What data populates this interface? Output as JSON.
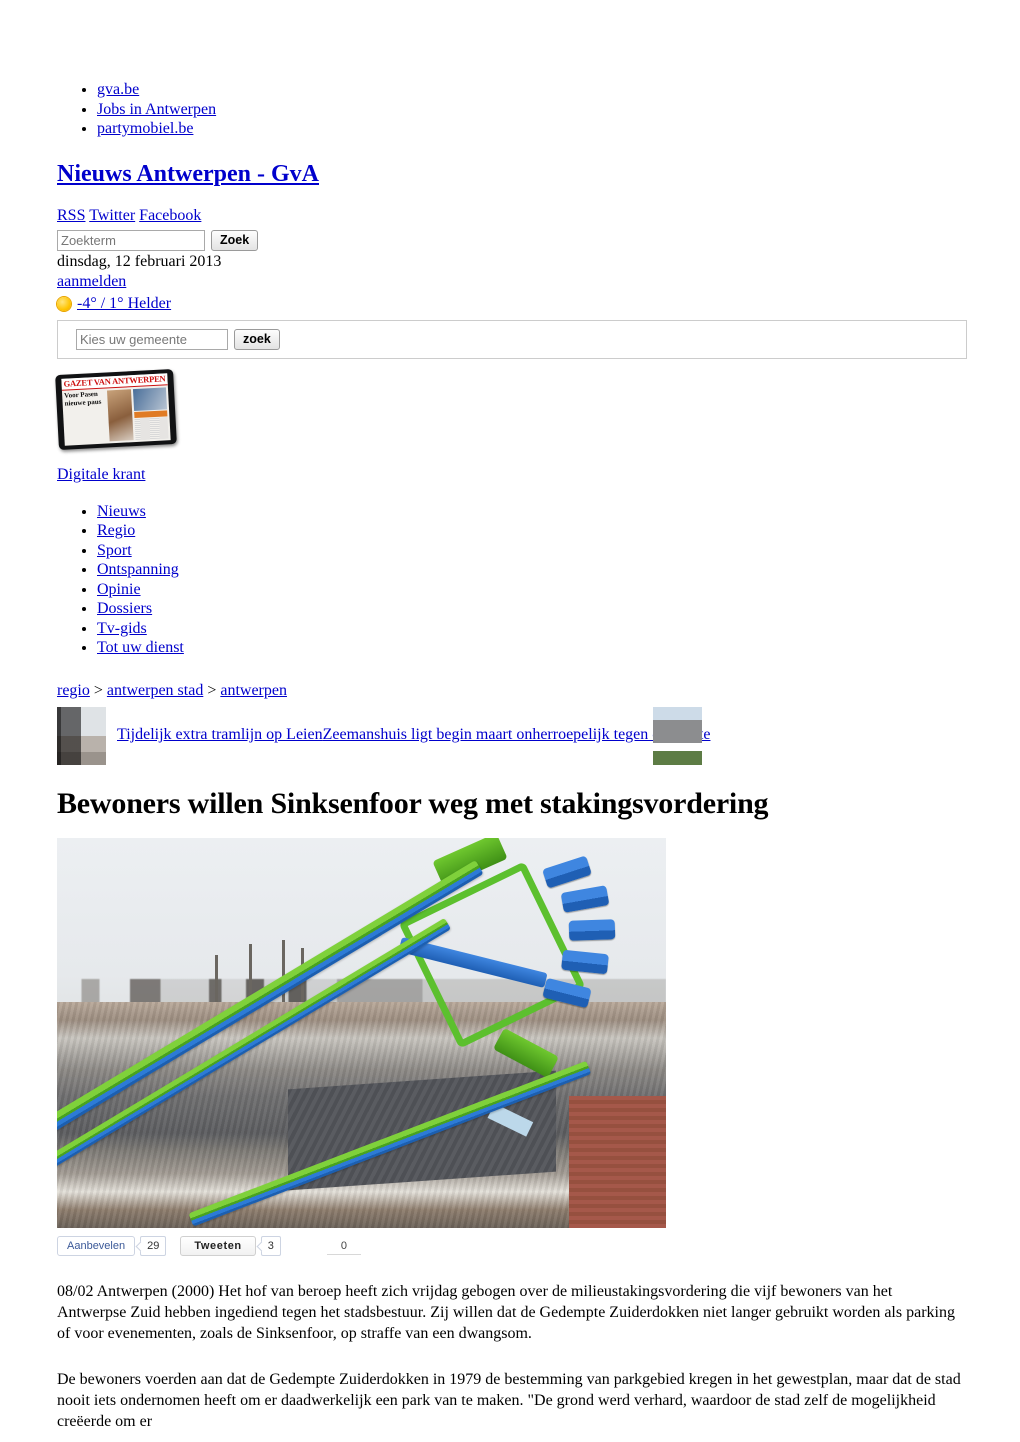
{
  "top_links": [
    {
      "label": "gva.be"
    },
    {
      "label": "Jobs in Antwerpen"
    },
    {
      "label": "partymobiel.be"
    }
  ],
  "site": {
    "title": "Nieuws Antwerpen - GvA"
  },
  "social_links": [
    {
      "label": "RSS"
    },
    {
      "label": "Twitter"
    },
    {
      "label": "Facebook"
    }
  ],
  "search": {
    "placeholder": "Zoekterm",
    "value": "",
    "button_label": "Zoek"
  },
  "date": "dinsdag, 12 februari 2013",
  "login": {
    "label": "aanmelden"
  },
  "weather": {
    "icon": "sun-icon",
    "text": "-4° / 1° Helder"
  },
  "gemeente": {
    "placeholder": "Kies uw gemeente",
    "value": "",
    "button_label": "zoek"
  },
  "krant": {
    "masthead": "GAZET VAN ANTWERPEN",
    "front_headline": "Voor Pasen nieuwe paus",
    "link_label": "Digitale krant"
  },
  "nav": [
    {
      "label": "Nieuws"
    },
    {
      "label": "Regio"
    },
    {
      "label": "Sport"
    },
    {
      "label": "Ontspanning"
    },
    {
      "label": "Opinie"
    },
    {
      "label": "Dossiers"
    },
    {
      "label": "Tv-gids"
    },
    {
      "label": "Tot uw dienst"
    }
  ],
  "breadcrumb": {
    "items": [
      {
        "label": "regio"
      },
      {
        "label": "antwerpen stad"
      },
      {
        "label": "antwerpen"
      }
    ],
    "separator": ">"
  },
  "related": [
    {
      "label": "Tijdelijk extra tramlijn op Leien",
      "thumb": "tram-street-thumb"
    },
    {
      "label": "Zeemanshuis ligt begin maart onherroepelijk tegen de vlakte",
      "thumb": "building-thumb"
    }
  ],
  "article": {
    "headline": "Bewoners willen Sinksenfoor weg met stakingsvordering",
    "photo_alt": "kermisattractie boven de Antwerpse daken",
    "paragraphs": [
      "08/02 Antwerpen (2000) Het hof van beroep heeft zich vrijdag gebogen over de milieustakingsvordering die vijf bewoners van het Antwerpse Zuid hebben ingediend tegen het stadsbestuur. Zij willen dat de Gedempte Zuiderdokken niet langer gebruikt worden als parking of voor evenementen, zoals de Sinksenfoor, op straffe van een dwangsom.",
      "De bewoners voerden aan dat de Gedempte Zuiderdokken in 1979 de bestemming van parkgebied kregen in het gewestplan, maar dat de stad nooit iets ondernomen heeft om er daadwerkelijk een park van te maken. \"De grond werd verhard, waardoor de stad zelf de mogelijkheid creëerde om er"
    ]
  },
  "share": {
    "facebook_label": "Aanbevelen",
    "facebook_count": "29",
    "twitter_label": "Tweeten",
    "twitter_count": "3",
    "google_count": "0"
  },
  "colors": {
    "link": "#0000cc",
    "text": "#000000",
    "background": "#ffffff"
  }
}
